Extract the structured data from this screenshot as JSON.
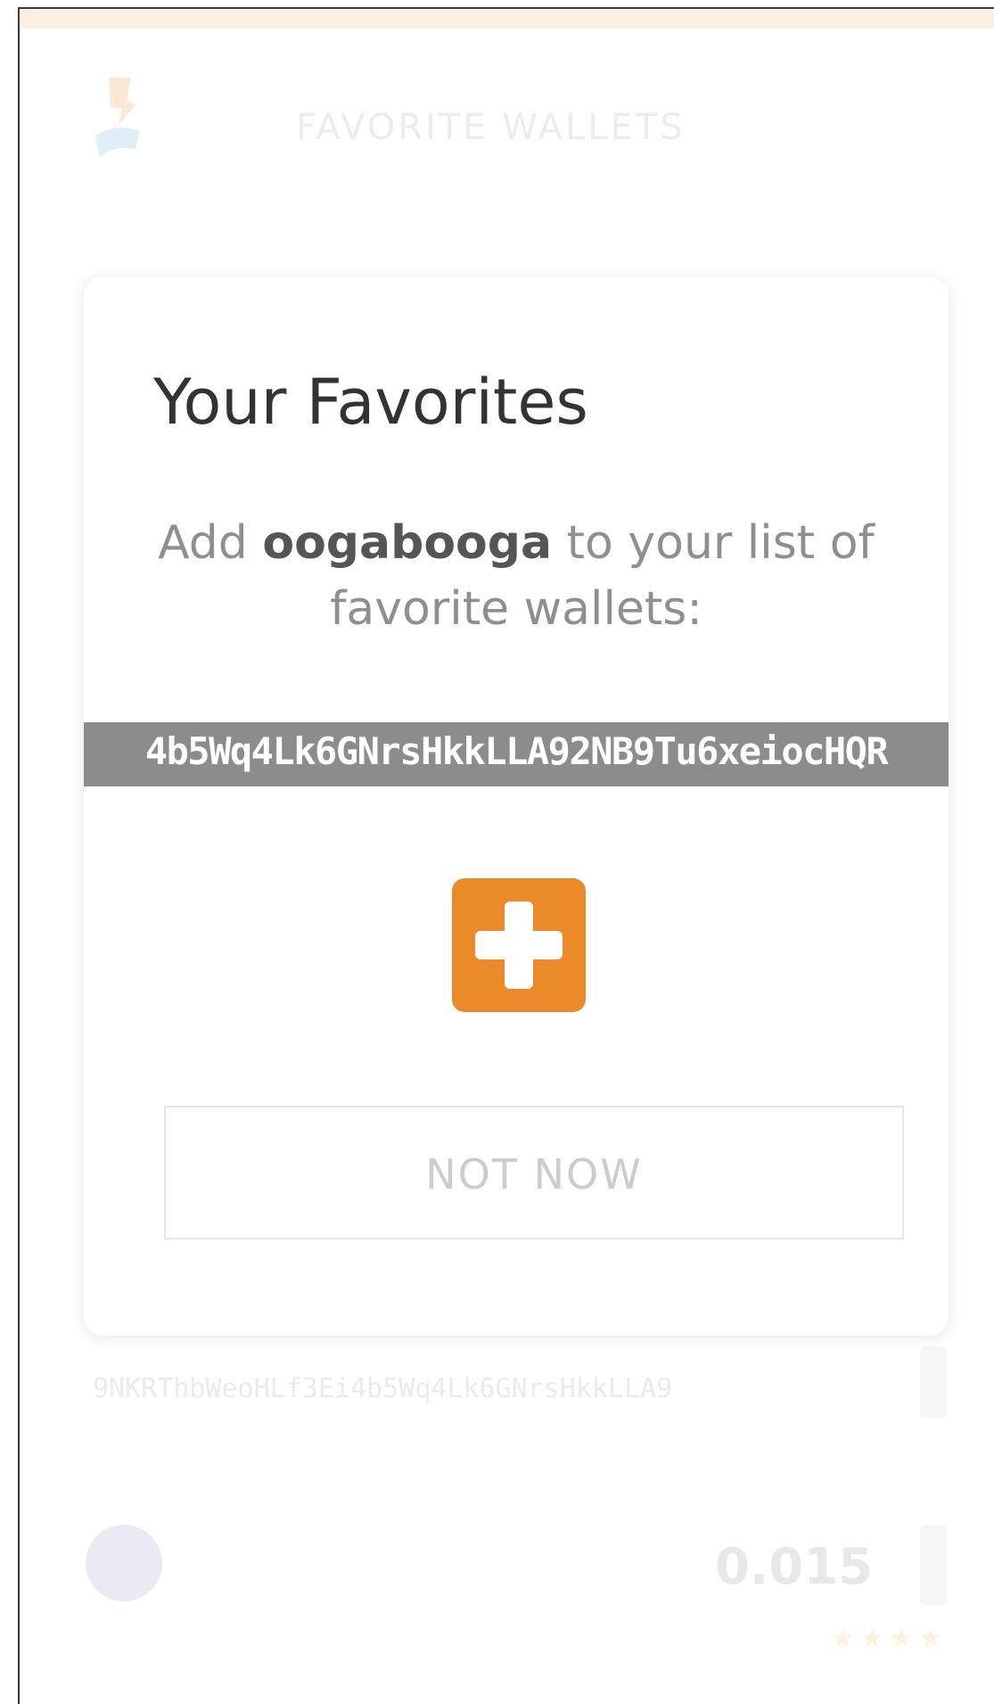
{
  "header": {
    "title": "FAVORITE WALLETS"
  },
  "background": {
    "address_preview": "9NKRThbWeoHLf3Ei4b5Wq4Lk6GNrsHkkLLA9",
    "balance": "0.015",
    "rating_stars": "★★★★"
  },
  "modal": {
    "title": "Your Favorites",
    "desc_prefix": "Add ",
    "wallet_name": "oogabooga",
    "desc_suffix": " to your list of favorite wallets:",
    "wallet_address": "4b5Wq4Lk6GNrsHkkLLA92NB9Tu6xeiocHQR",
    "add_button_icon": "plus-icon",
    "not_now_label": "NOT NOW"
  },
  "colors": {
    "accent": "#ec8a2a",
    "address_bg": "#8c8c8c",
    "top_strip": "#fcefe2"
  }
}
